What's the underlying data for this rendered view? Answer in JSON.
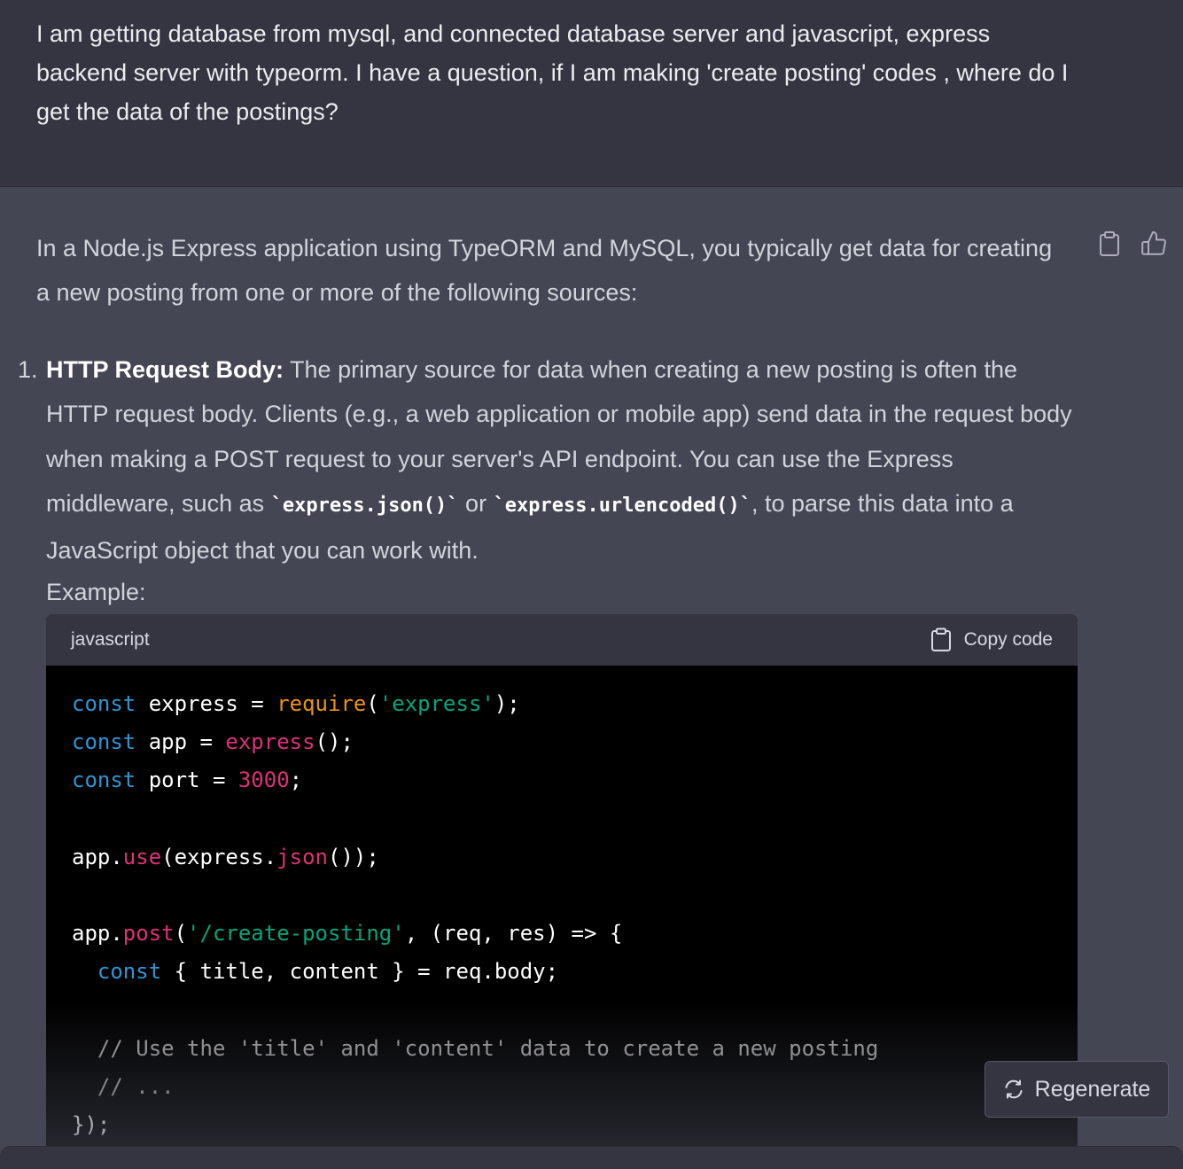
{
  "user_message": {
    "text": "I am getting database from mysql, and connected database server and javascript, express backend server with typeorm.  I have a question, if I am making 'create posting' codes , where do I get the data of the postings?"
  },
  "assistant_message": {
    "intro": "In a Node.js Express application using TypeORM and MySQL, you typically get data for creating a new posting from one or more of the following sources:",
    "actions": {
      "copy_icon": "clipboard-icon",
      "thumbs_up_icon": "thumbs-up-icon"
    },
    "list_item": {
      "number": "1.",
      "title": "HTTP Request Body:",
      "text_1": " The primary source for data when creating a new posting is often the HTTP request body. Clients (e.g., a web application or mobile app) send data in the request body when making a POST request to your server's API endpoint. You can use the Express middleware, such as ",
      "code_1": "`express.json()`",
      "text_2": " or ",
      "code_2": "`express.urlencoded()`",
      "text_3": ", to parse this data into a JavaScript object that you can work with.",
      "example_label": "Example:"
    },
    "code_block": {
      "language": "javascript",
      "copy_label": "Copy code",
      "colors": {
        "keyword": "#2e95d3",
        "function": "#e9950c",
        "string": "#00a67d",
        "call": "#df3079",
        "comment": "#a0a0a0"
      },
      "lines": [
        [
          {
            "t": "const",
            "c": "kw"
          },
          {
            "t": " express = "
          },
          {
            "t": "require",
            "c": "fn"
          },
          {
            "t": "("
          },
          {
            "t": "'express'",
            "c": "str"
          },
          {
            "t": ");"
          }
        ],
        [
          {
            "t": "const",
            "c": "kw"
          },
          {
            "t": " app = "
          },
          {
            "t": "express",
            "c": "red"
          },
          {
            "t": "();"
          }
        ],
        [
          {
            "t": "const",
            "c": "kw"
          },
          {
            "t": " port = "
          },
          {
            "t": "3000",
            "c": "red"
          },
          {
            "t": ";"
          }
        ],
        [],
        [
          {
            "t": "app."
          },
          {
            "t": "use",
            "c": "red"
          },
          {
            "t": "(express."
          },
          {
            "t": "json",
            "c": "red"
          },
          {
            "t": "());"
          }
        ],
        [],
        [
          {
            "t": "app."
          },
          {
            "t": "post",
            "c": "red"
          },
          {
            "t": "("
          },
          {
            "t": "'/create-posting'",
            "c": "str"
          },
          {
            "t": ", (req, res) => {"
          }
        ],
        [
          {
            "t": "  "
          },
          {
            "t": "const",
            "c": "kw"
          },
          {
            "t": " { title, content } = req.body;"
          }
        ],
        [],
        [
          {
            "t": "  // Use the 'title' and 'content' data to create a new posting",
            "c": "cm"
          }
        ],
        [
          {
            "t": "  // ...",
            "c": "cm"
          }
        ],
        [
          {
            "t": "});"
          }
        ]
      ]
    }
  },
  "regenerate": {
    "label": "Regenerate",
    "icon": "refresh-icon"
  }
}
